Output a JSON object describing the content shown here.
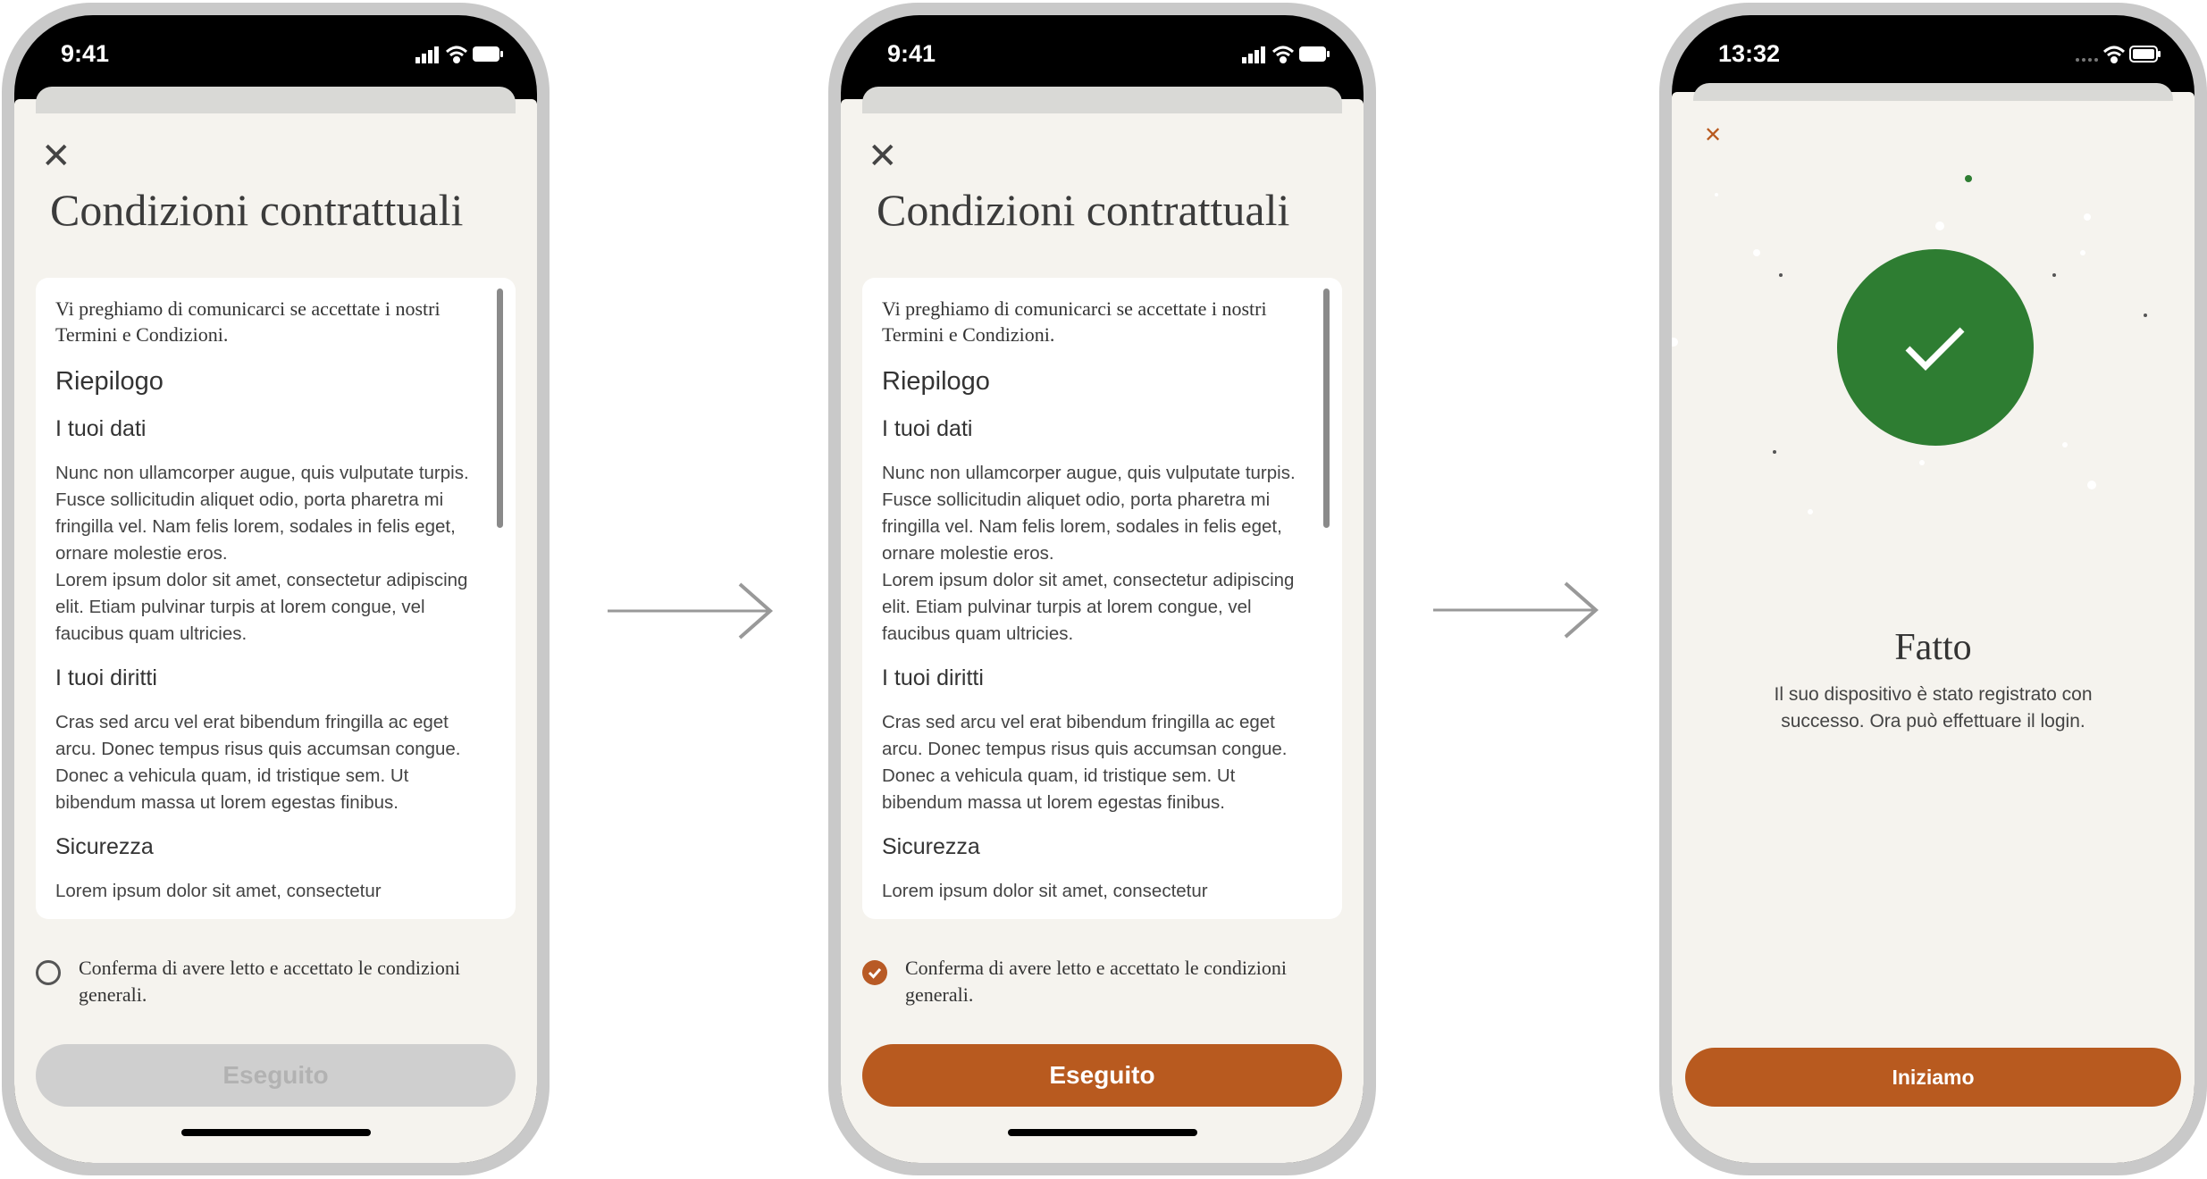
{
  "colors": {
    "accent": "#b85a1f",
    "success": "#2e7d32",
    "background": "#f5f3ee"
  },
  "screens": [
    {
      "time": "9:41",
      "title": "Condizioni contrattuali",
      "intro": "Vi preghiamo di comunicarci se accettate i nostri Termini e Condizioni.",
      "summary_heading": "Riepilogo",
      "section1_heading": "I tuoi dati",
      "section1_text": "Nunc non ullamcorper augue, quis vulputate turpis.  Fusce sollicitudin aliquet odio, porta pharetra mi fringilla vel. Nam felis lorem, sodales in felis eget, ornare molestie eros.",
      "section1_text2": "Lorem ipsum dolor sit amet, consectetur adipiscing elit. Etiam pulvinar turpis at lorem congue, vel faucibus quam ultricies.",
      "section2_heading": "I tuoi diritti",
      "section2_text": "Cras sed arcu vel erat bibendum fringilla ac eget arcu. Donec tempus risus quis accumsan congue. Donec a vehicula quam, id tristique sem. Ut bibendum massa ut lorem egestas finibus.",
      "section3_heading": "Sicurezza",
      "section3_text": "Lorem ipsum dolor sit amet, consectetur",
      "confirm_text": "Conferma di avere letto e accettato le condizioni generali.",
      "confirm_checked": false,
      "button_label": "Eseguito",
      "button_enabled": false
    },
    {
      "time": "9:41",
      "title": "Condizioni contrattuali",
      "intro": "Vi preghiamo di comunicarci se accettate i nostri Termini e Condizioni.",
      "summary_heading": "Riepilogo",
      "section1_heading": "I tuoi dati",
      "section1_text": "Nunc non ullamcorper augue, quis vulputate turpis.  Fusce sollicitudin aliquet odio, porta pharetra mi fringilla vel. Nam felis lorem, sodales in felis eget, ornare molestie eros.",
      "section1_text2": "Lorem ipsum dolor sit amet, consectetur adipiscing elit. Etiam pulvinar turpis at lorem congue, vel faucibus quam ultricies.",
      "section2_heading": "I tuoi diritti",
      "section2_text": "Cras sed arcu vel erat bibendum fringilla ac eget arcu. Donec tempus risus quis accumsan congue. Donec a vehicula quam, id tristique sem. Ut bibendum massa ut lorem egestas finibus.",
      "section3_heading": "Sicurezza",
      "section3_text": "Lorem ipsum dolor sit amet, consectetur",
      "confirm_text": "Conferma di avere letto e accettato le condizioni generali.",
      "confirm_checked": true,
      "button_label": "Eseguito",
      "button_enabled": true
    },
    {
      "time": "13:32",
      "heading": "Fatto",
      "message": "Il suo dispositivo è stato registrato con successo. Ora può effettuare il login.",
      "button_label": "Iniziamo"
    }
  ],
  "icons": {
    "close": "close-icon",
    "check": "checkmark-icon",
    "arrow": "arrow-right-icon",
    "signal": "signal-icon",
    "wifi": "wifi-icon",
    "battery": "battery-icon"
  }
}
